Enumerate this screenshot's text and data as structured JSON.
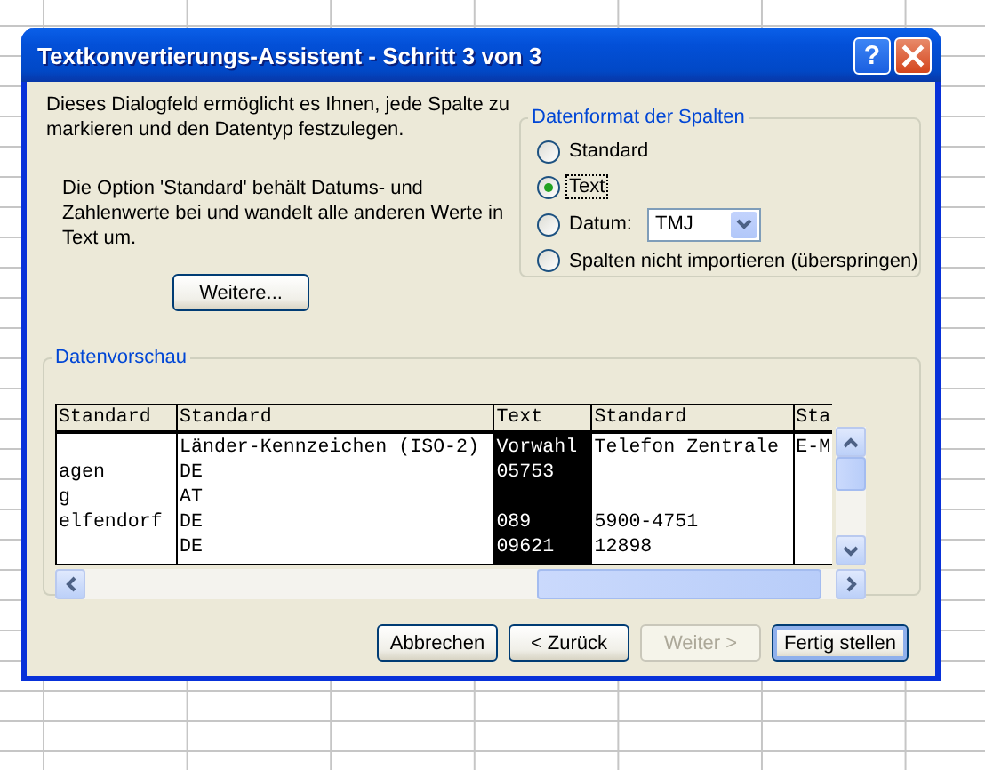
{
  "window": {
    "title": "Textkonvertierungs-Assistent - Schritt 3 von 3",
    "help_button": "?"
  },
  "intro": "Dieses Dialogfeld ermöglicht es Ihnen, jede Spalte zu markieren und den Datentyp festzulegen.",
  "note": "Die Option 'Standard' behält Datums- und Zahlenwerte bei und wandelt alle anderen Werte in Text um.",
  "more_button": "Weitere...",
  "format_group": {
    "title": "Datenformat der Spalten",
    "options": [
      {
        "label": "Standard",
        "selected": false
      },
      {
        "label": "Text",
        "selected": true
      },
      {
        "label": "Datum:",
        "selected": false,
        "dropdown": "TMJ"
      },
      {
        "label": "Spalten nicht importieren (überspringen)",
        "selected": false
      }
    ]
  },
  "preview": {
    "title": "Datenvorschau",
    "columns": [
      {
        "header": "Standard",
        "selected": false,
        "cells": [
          null,
          "agen",
          "g",
          "elfendorf",
          null
        ]
      },
      {
        "header": "Standard",
        "selected": false,
        "cells": [
          "Länder-Kennzeichen (ISO-2)",
          "DE",
          "AT",
          "DE",
          "DE"
        ]
      },
      {
        "header": "Text",
        "selected": true,
        "cells": [
          "Vorwahl",
          "05753",
          null,
          "089",
          "09621"
        ]
      },
      {
        "header": "Standard",
        "selected": false,
        "cells": [
          "Telefon Zentrale",
          null,
          null,
          "5900-4751",
          "12898"
        ]
      },
      {
        "header": "Sta",
        "selected": false,
        "cells": [
          "E-M",
          null,
          null,
          null,
          null
        ]
      }
    ]
  },
  "buttons": [
    {
      "label": "Abbrechen",
      "disabled": false,
      "default": false
    },
    {
      "label": "< Zurück",
      "disabled": false,
      "default": false
    },
    {
      "label": "Weiter >",
      "disabled": true,
      "default": false
    },
    {
      "label": "Fertig stellen",
      "disabled": false,
      "default": true
    }
  ]
}
